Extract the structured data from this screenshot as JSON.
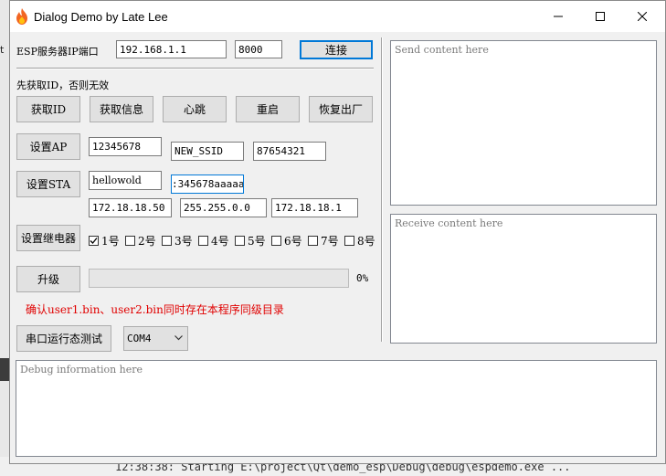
{
  "background": {
    "left_edge_text": "t",
    "console_text": "12:38:38: Starting E:\\project\\Qt\\demo_esp\\Debug\\debug\\espdemo.exe ..."
  },
  "window": {
    "title": "Dialog Demo by Late Lee",
    "minimize_symbol": "—",
    "maximize_symbol": "☐",
    "close_symbol": "✕"
  },
  "connection": {
    "label": "ESP服务器IP端口",
    "ip": "192.168.1.1",
    "port": "8000",
    "connect_label": "连接"
  },
  "notice": "先获取ID，否则无效",
  "actions": {
    "get_id": "获取ID",
    "get_info": "获取信息",
    "heartbeat": "心跳",
    "restart": "重启",
    "factory_reset": "恢复出厂"
  },
  "ap": {
    "button": "设置AP",
    "password": "12345678",
    "ssid": "NEW_SSID",
    "field3": "87654321"
  },
  "sta": {
    "button": "设置STA",
    "ssid": "hellowold",
    "password": ":345678aaaaaa",
    "ip": "172.18.18.50",
    "mask": "255.255.0.0",
    "gateway": "172.18.18.1"
  },
  "relay": {
    "button": "设置继电器",
    "channels": [
      {
        "label": "1号",
        "checked": true
      },
      {
        "label": "2号",
        "checked": false
      },
      {
        "label": "3号",
        "checked": false
      },
      {
        "label": "4号",
        "checked": false
      },
      {
        "label": "5号",
        "checked": false
      },
      {
        "label": "6号",
        "checked": false
      },
      {
        "label": "7号",
        "checked": false
      },
      {
        "label": "8号",
        "checked": false
      }
    ]
  },
  "upgrade": {
    "button": "升级",
    "progress_percent": 0,
    "progress_text": "0%",
    "warning": "确认user1.bin、user2.bin同时存在本程序同级目录"
  },
  "serial": {
    "button": "串口运行态测试",
    "port": "COM4"
  },
  "send": {
    "placeholder": "Send content here"
  },
  "receive": {
    "placeholder": "Receive content here"
  },
  "debug": {
    "placeholder": "Debug information here"
  },
  "colors": {
    "warning": "#e00000",
    "focus": "#0078d7"
  }
}
